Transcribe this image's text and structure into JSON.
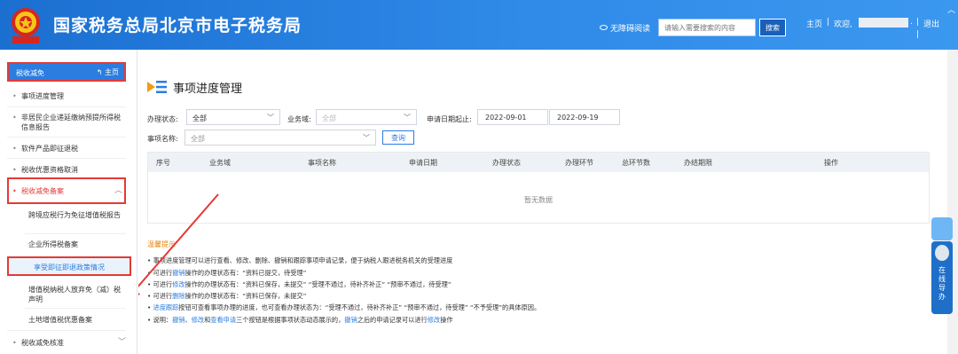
{
  "header": {
    "site_title": "国家税务总局北京市电子税务局",
    "accessibility_label": "无障碍阅读",
    "search_placeholder": "请输入需要搜索的内容",
    "search_button": "搜索",
    "home_link": "主页",
    "separator": "|",
    "welcome": "欢迎,",
    "dot": ".",
    "logout": "退出"
  },
  "sidebar": {
    "head_title": "税收减免",
    "home": "主页",
    "items": [
      {
        "label": "事项进度管理"
      },
      {
        "label": "非居民企业递延缴纳预提所得税信息报告"
      },
      {
        "label": "软件产品即征退税"
      },
      {
        "label": "税收优惠资格取消"
      }
    ],
    "group": {
      "label": "税收减免备案",
      "sub_items": [
        {
          "label": "跨境应税行为免征增值税报告"
        },
        {
          "label": "企业所得税备案"
        },
        {
          "label": "享受即征即退政策情况"
        },
        {
          "label": "增值税纳税人放弃免（减）税声明"
        },
        {
          "label": "土地增值税优惠备案"
        }
      ]
    },
    "last_item": {
      "label": "税收减免核准"
    }
  },
  "main": {
    "page_title": "事项进度管理",
    "filters": {
      "status_label": "办理状态:",
      "status_value": "全部",
      "domain_label": "业务域:",
      "domain_value": "全部",
      "date_label": "申请日期起止:",
      "date_from": "2022-09-01",
      "date_dash": "-",
      "date_to": "2022-09-19",
      "item_label": "事项名称:",
      "item_value": "全部",
      "query_button": "查询"
    },
    "table": {
      "columns": [
        "序号",
        "业务域",
        "事项名称",
        "申请日期",
        "办理状态",
        "办理环节",
        "总环节数",
        "办结期限",
        "操作"
      ],
      "empty_text": "暂无数据"
    },
    "tips_title": "温馨提示",
    "tips": [
      {
        "parts": [
          {
            "t": "事项进度管理可以进行查看、修改、删除、撤销和跟踪事项申请记录，便于纳税人跟进税务机关的受理进度"
          }
        ]
      },
      {
        "parts": [
          {
            "t": "可进行"
          },
          {
            "t": "撤销",
            "link": true
          },
          {
            "t": "操作的办理状态有：“资料已提交，待受理”"
          }
        ]
      },
      {
        "parts": [
          {
            "t": "可进行"
          },
          {
            "t": "修改",
            "link": true
          },
          {
            "t": "操作的办理状态有：“资料已保存，未提交”  “受理不通过，待补齐补正”  “预审不通过，待受理”"
          }
        ]
      },
      {
        "parts": [
          {
            "t": "可进行"
          },
          {
            "t": "删除",
            "link": true
          },
          {
            "t": "操作的办理状态有：“资料已保存，未提交”"
          }
        ]
      },
      {
        "parts": [
          {
            "t": "进度跟踪",
            "link": true
          },
          {
            "t": "按钮可查看事项办理的进度，也可查看办理状态为：“受理不通过，待补齐补正”  “预审不通过，待受理”  “不予受理”的具体原因。"
          }
        ]
      },
      {
        "parts": [
          {
            "t": "说明："
          },
          {
            "t": "撤销",
            "link": true
          },
          {
            "t": "、"
          },
          {
            "t": "修改",
            "link": true
          },
          {
            "t": "和"
          },
          {
            "t": "查看申请",
            "link": true
          },
          {
            "t": "三个按钮是根据事项状态动态展示的，"
          },
          {
            "t": "撤销",
            "link": true
          },
          {
            "t": "之后的申请记录可以进行"
          },
          {
            "t": "修改",
            "link": true
          },
          {
            "t": "操作"
          }
        ]
      }
    ]
  },
  "float": {
    "guide_text": "在线导办"
  },
  "colors": {
    "brand_blue": "#2b7de0",
    "highlight_red": "#e53935",
    "tips_orange": "#e8860c"
  }
}
